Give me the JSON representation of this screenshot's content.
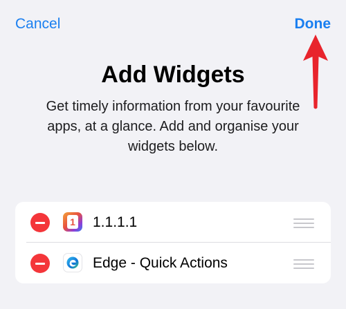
{
  "nav": {
    "cancel_label": "Cancel",
    "done_label": "Done"
  },
  "header": {
    "title": "Add Widgets",
    "subtitle": "Get timely information from your favourite apps, at a glance. Add and organise your widgets below."
  },
  "widgets": [
    {
      "label": "1.1.1.1",
      "icon": "cloudflare-1111-app-icon",
      "remove_icon": "minus-circle-icon",
      "reorder_icon": "drag-handle-icon"
    },
    {
      "label": "Edge - Quick Actions",
      "icon": "microsoft-edge-app-icon",
      "remove_icon": "minus-circle-icon",
      "reorder_icon": "drag-handle-icon"
    }
  ],
  "annotation": {
    "icon": "red-arrow-up-icon",
    "color": "#e8242c"
  },
  "colors": {
    "accent": "#1a7ff0",
    "destructive": "#f4363a",
    "background": "#f2f2f6",
    "card": "#ffffff"
  }
}
